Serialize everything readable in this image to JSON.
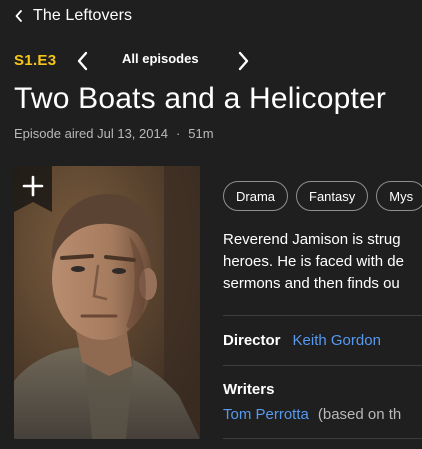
{
  "nav": {
    "back_label": "The Leftovers"
  },
  "episode": {
    "code": "S1.E3",
    "all_episodes_label": "All episodes",
    "title": "Two Boats and a Helicopter",
    "aired": "Episode aired Jul 13, 2014",
    "separator": "·",
    "runtime": "51m"
  },
  "genres": [
    "Drama",
    "Fantasy",
    "Mys"
  ],
  "plot_lines": [
    "Reverend Jamison is strug",
    "heroes. He is faced with de",
    "sermons and then finds ou"
  ],
  "credits": {
    "director_label": "Director",
    "director": "Keith Gordon",
    "writers_label": "Writers",
    "writer": "Tom Perrotta",
    "writer_note": "(based on th"
  },
  "colors": {
    "accent": "#f5c518",
    "link": "#5799ef",
    "background": "#1f1f1f"
  }
}
